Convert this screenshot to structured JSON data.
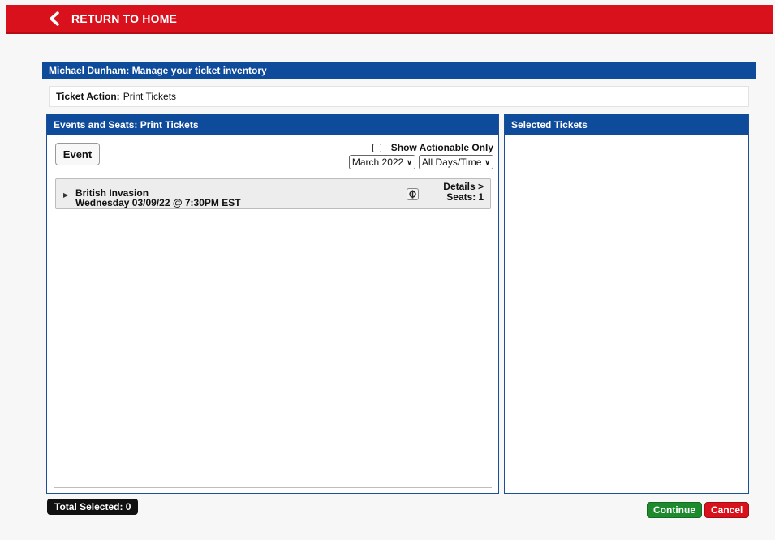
{
  "nav": {
    "return_label": "RETURN TO HOME"
  },
  "header": {
    "title": "Michael Dunham: Manage your ticket inventory"
  },
  "ticket_action": {
    "label": "Ticket Action:",
    "value": "Print Tickets"
  },
  "events_panel": {
    "title": "Events and Seats: Print Tickets",
    "event_button": "Event",
    "actionable_label": "Show Actionable Only",
    "actionable_checked": false,
    "month_select": "March 2022",
    "days_select": "All Days/Time",
    "events": [
      {
        "name": "British Invasion",
        "datetime": "Wednesday 03/09/22 @ 7:30PM EST",
        "details_label": "Details >",
        "seats_label": "Seats:",
        "seats_count": "1"
      }
    ]
  },
  "selected_panel": {
    "title": "Selected Tickets"
  },
  "footer": {
    "total_selected": "Total Selected: 0",
    "continue_label": "Continue",
    "cancel_label": "Cancel"
  },
  "colors": {
    "brand_red": "#d9111c",
    "header_blue": "#0e4b9a",
    "continue_green": "#1e8a2e"
  },
  "icons": {
    "return": "chevron-left-icon",
    "expand": "caret-right-icon",
    "refresh": "refresh-icon",
    "dropdown": "chevron-down-icon"
  }
}
